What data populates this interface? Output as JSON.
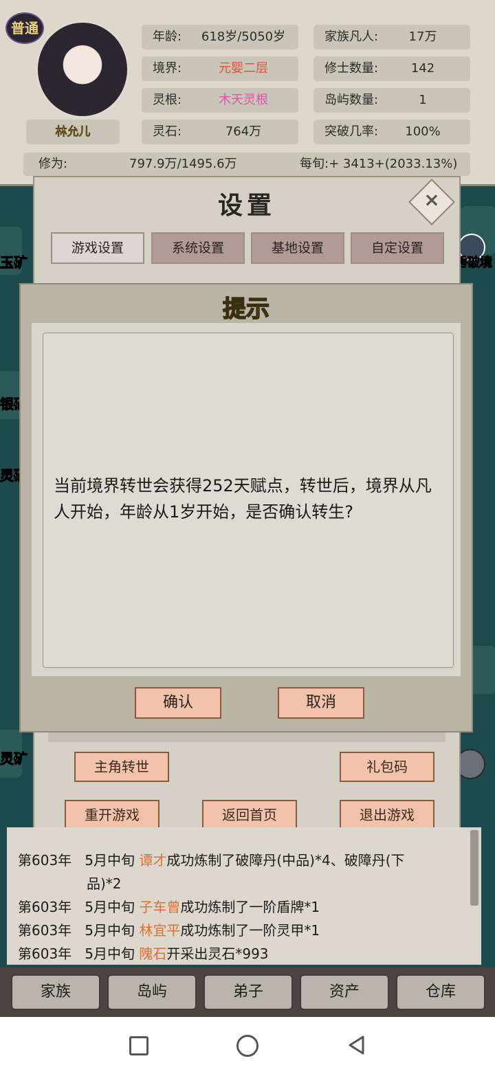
{
  "header": {
    "badge": "普通",
    "character_name": "林允儿",
    "stats_left": [
      {
        "label": "年龄:",
        "value": "618岁/5050岁"
      },
      {
        "label": "境界:",
        "value": "元婴二层"
      },
      {
        "label": "灵根:",
        "value": "木天灵根"
      },
      {
        "label": "灵石:",
        "value": "764万"
      }
    ],
    "stats_right": [
      {
        "label": "家族凡人:",
        "value": "17万"
      },
      {
        "label": "修士数量:",
        "value": "142"
      },
      {
        "label": "岛屿数量:",
        "value": "1"
      },
      {
        "label": "突破几率:",
        "value": "100%"
      }
    ],
    "cultivation": {
      "label": "修为:",
      "value": "797.9万/1495.6万",
      "rate": "每旬:+ 3413+(2033.13%)"
    }
  },
  "side_labels": {
    "left": [
      "玉矿",
      "银矿",
      "灵矿",
      "灵矿"
    ],
    "right": [
      "秀破境"
    ]
  },
  "settings": {
    "title": "设置",
    "tabs": [
      "游戏设置",
      "系统设置",
      "基地设置",
      "自定设置"
    ],
    "active_tab_index": 0,
    "buttons": {
      "reincarnate": "主角转世",
      "gift_code": "礼包码",
      "restart": "重开游戏",
      "home": "返回首页",
      "quit": "退出游戏"
    }
  },
  "dialog": {
    "title": "提示",
    "message": "当前境界转世会获得252天赋点，转世后，境界从凡人开始，年龄从1岁开始，是否确认转生?",
    "confirm": "确认",
    "cancel": "取消"
  },
  "log": [
    {
      "year": "第603年",
      "time": "5月中旬",
      "name": "谭才",
      "text": "成功炼制了破障丹(中品)*4、破障丹(下",
      "cont": "品)*2"
    },
    {
      "year": "第603年",
      "time": "5月中旬",
      "name": "子车曾",
      "text": "成功炼制了一阶盾牌*1"
    },
    {
      "year": "第603年",
      "time": "5月中旬",
      "name": "林宜平",
      "text": "成功炼制了一阶灵甲*1"
    },
    {
      "year": "第603年",
      "time": "5月中旬",
      "name": "隗石",
      "text": "开采出灵石*993"
    }
  ],
  "bottom_nav": [
    "家族",
    "岛屿",
    "弟子",
    "资产",
    "仓库"
  ],
  "colors": {
    "accent_title": "#f6dd3c",
    "button_fill": "#f2c3aa",
    "highlight_red": "#e0533b",
    "highlight_pink": "#d65aa6"
  }
}
